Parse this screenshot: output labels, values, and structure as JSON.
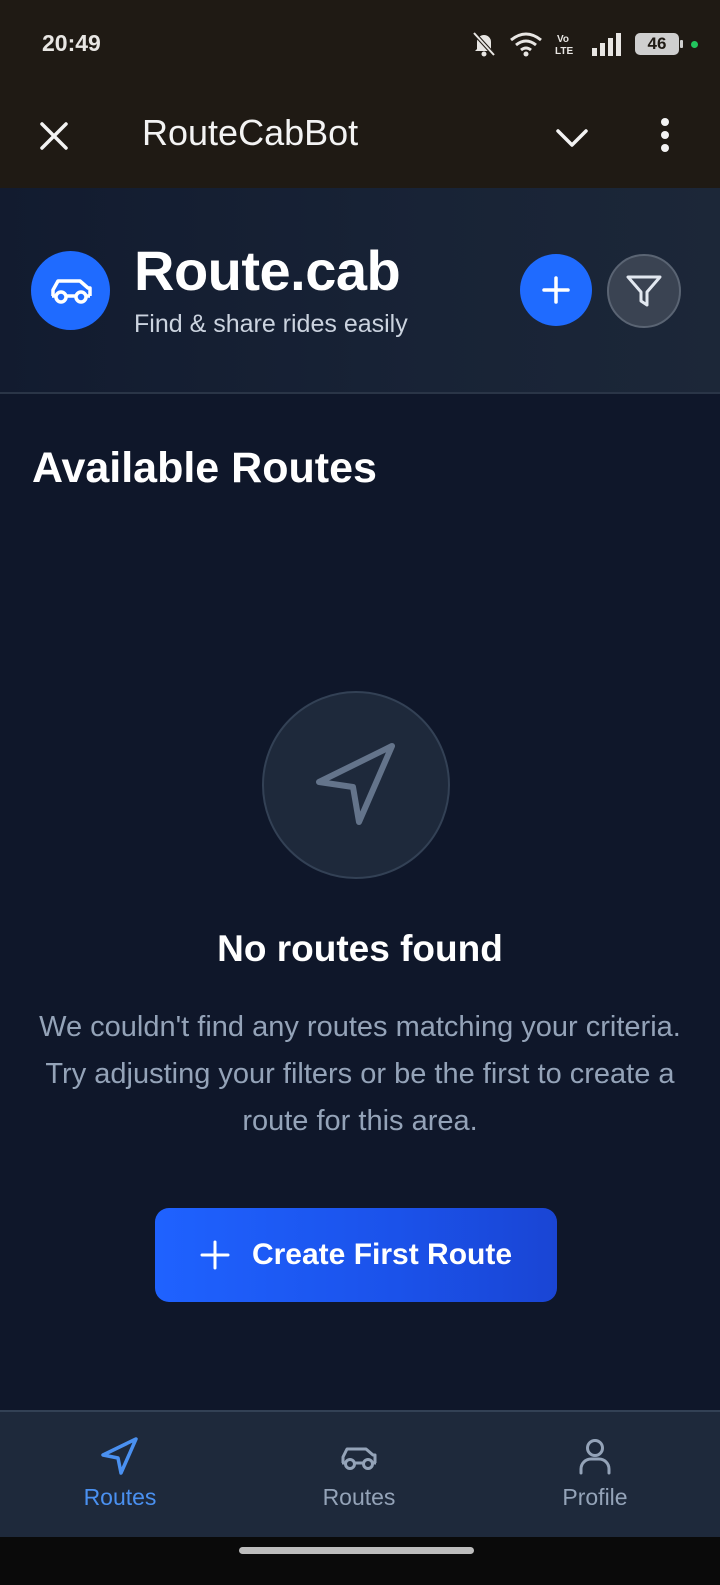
{
  "status_bar": {
    "time": "20:49",
    "battery_level": "46",
    "icons": [
      "bell-muted-icon",
      "wifi-icon",
      "volte-icon",
      "signal-icon",
      "battery-icon"
    ]
  },
  "header": {
    "title": "RouteCabBot",
    "close_icon": "close-icon",
    "chevron_icon": "chevron-down-icon",
    "more_icon": "more-vertical-icon"
  },
  "brand": {
    "name": "Route.cab",
    "tagline": "Find & share rides easily",
    "logo_icon": "car-icon",
    "add_icon": "plus-icon",
    "filter_icon": "filter-icon"
  },
  "main": {
    "section_title": "Available Routes",
    "empty_icon": "navigation-arrow-icon",
    "empty_title": "No routes found",
    "empty_text": "We couldn't find any routes matching your criteria. Try adjusting your filters or be the first to create a route for this area.",
    "create_button_label": "Create First Route"
  },
  "bottom_nav": {
    "items": [
      {
        "label": "Routes",
        "icon": "navigation-arrow-icon",
        "active": true
      },
      {
        "label": "Routes",
        "icon": "car-icon",
        "active": false
      },
      {
        "label": "Profile",
        "icon": "user-icon",
        "active": false
      }
    ]
  },
  "colors": {
    "accent": "#1f6bff",
    "background": "#0f172a",
    "active_nav": "#4a90f0",
    "muted_text": "#94a3b8"
  }
}
